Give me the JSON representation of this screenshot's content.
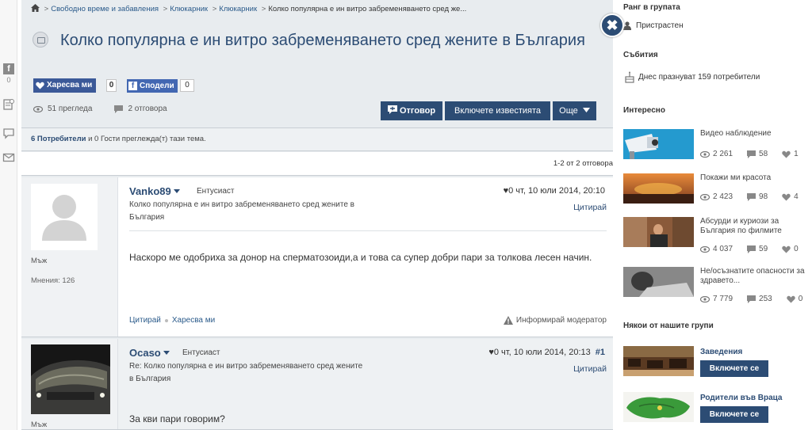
{
  "breadcrumb": {
    "items": [
      "Свободно време и забавления",
      "Клюкарник",
      "Клюкарник",
      "Колко популярна е ин витро забременяването сред же..."
    ]
  },
  "topic": {
    "title": "Колко популярна е ин витро забременяването сред жените в България",
    "like_label": "Харесва ми",
    "like_count": "0",
    "share_label": "Сподели",
    "share_count": "0",
    "views": "51 прегледа",
    "replies": "2 отговора",
    "reply_button": "Отговор",
    "notify_button": "Включете известията",
    "more_button": "Още"
  },
  "viewers": {
    "users": "6 Потребители",
    "rest": "и 0 Гости преглежда(т) тази тема."
  },
  "pagination": "1-2 от 2 отговора",
  "posts": [
    {
      "author": "Vanko89",
      "rank": "Ентусиаст",
      "meta": "♥0  чт, 10 юли 2014, 20:10",
      "number": "",
      "subject": "Колко популярна е ин витро забременяването сред жените в България",
      "quote": "Цитирай",
      "gender": "Мъж",
      "messages": "Мнения: 126",
      "body": "Наскоро ме одобриха за донор на сперматозоиди,а и това са супер добри пари за толкова лесен начин.",
      "action_quote": "Цитирай",
      "action_like": "Харесва ми",
      "report": "Информирай модератор"
    },
    {
      "author": "Ocaso",
      "rank": "Ентусиаст",
      "meta": "♥0  чт, 10 юли 2014, 20:13",
      "number": "#1",
      "subject": "Re: Колко популярна е ин витро забременяването сред жените в България",
      "quote": "Цитирай",
      "gender": "Мъж",
      "body": "За кви пари говорим?"
    }
  ],
  "sidebar": {
    "close": "✖",
    "rank_title": "Ранг в групата",
    "rank_value": "Пристрастен",
    "events_title": "Събития",
    "events_text": "Днес празнуват 159 потребители",
    "interesting_title": "Интересно",
    "interesting": [
      {
        "title": "Видео наблюдение",
        "views": "2 261",
        "comments": "58",
        "likes": "1"
      },
      {
        "title": "Покажи ми красота",
        "views": "2 423",
        "comments": "98",
        "likes": "4"
      },
      {
        "title": "Абсурди и куриози за България по филмите",
        "views": "4 037",
        "comments": "59",
        "likes": "0"
      },
      {
        "title": "Не/осъзнатите опасности за здравето...",
        "views": "7 779",
        "comments": "253",
        "likes": "0"
      }
    ],
    "groups_title": "Някои от нашите групи",
    "groups": [
      {
        "name": "Заведения",
        "join": "Включете се"
      },
      {
        "name": "Родители във Враца",
        "join": "Включете се"
      }
    ]
  },
  "left_strip": {
    "fb_count": "0"
  }
}
